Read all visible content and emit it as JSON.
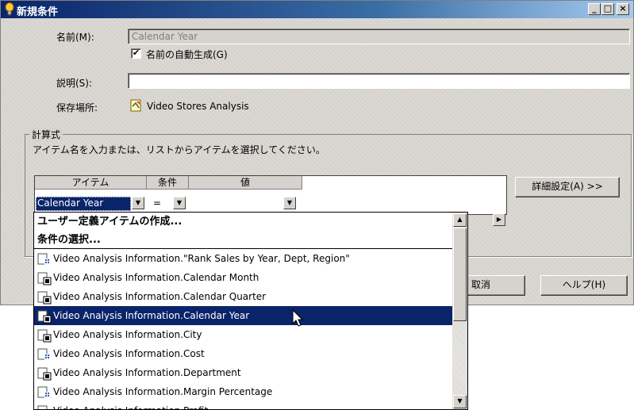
{
  "window": {
    "title": "新規条件",
    "minimize": "_",
    "maximize": "□",
    "close": "×"
  },
  "form": {
    "name_label": "名前(M):",
    "name_value": "Calendar Year",
    "auto_name_checked": true,
    "auto_name_label": "名前の自動生成(G)",
    "desc_label": "説明(S):",
    "desc_value": "",
    "location_label": "保存場所:",
    "location_value": "Video Stores Analysis"
  },
  "formula": {
    "group_label": "計算式",
    "instruction": "アイテム名を入力または、リストからアイテムを選択してください。",
    "columns": [
      "アイテム",
      "条件",
      "値"
    ],
    "item_value": "Calendar Year",
    "condition_value": "=",
    "value_value": "",
    "advanced_button": "詳細設定(A) >>"
  },
  "buttons": {
    "cancel": "取消",
    "help": "ヘルプ(H)"
  },
  "dropdown": {
    "items": [
      {
        "label": "ユーザー定義アイテムの作成...",
        "kind": "special",
        "icon": ""
      },
      {
        "label": "条件の選択...",
        "kind": "special",
        "icon": ""
      },
      {
        "label": "Video Analysis Information.\"Rank Sales by Year, Dept, Region\"",
        "kind": "item",
        "icon": "numeric-item-icon"
      },
      {
        "label": "Video Analysis Information.Calendar Month",
        "kind": "item",
        "icon": "dimension-item-icon"
      },
      {
        "label": "Video Analysis Information.Calendar Quarter",
        "kind": "item",
        "icon": "dimension-item-icon"
      },
      {
        "label": "Video Analysis Information.Calendar Year",
        "kind": "item",
        "icon": "dimension-item-icon",
        "selected": true
      },
      {
        "label": "Video Analysis Information.City",
        "kind": "item",
        "icon": "dimension-item-icon"
      },
      {
        "label": "Video Analysis Information.Cost",
        "kind": "item",
        "icon": "numeric-item-icon"
      },
      {
        "label": "Video Analysis Information.Department",
        "kind": "item",
        "icon": "dimension-item-icon"
      },
      {
        "label": "Video Analysis Information.Margin Percentage",
        "kind": "item",
        "icon": "numeric-item-icon"
      },
      {
        "label": "Video Analysis Information.Profit",
        "kind": "item",
        "icon": "numeric-item-icon"
      }
    ]
  },
  "colors": {
    "selection": "#0a246a",
    "window_bg": "#d6d3ce"
  }
}
